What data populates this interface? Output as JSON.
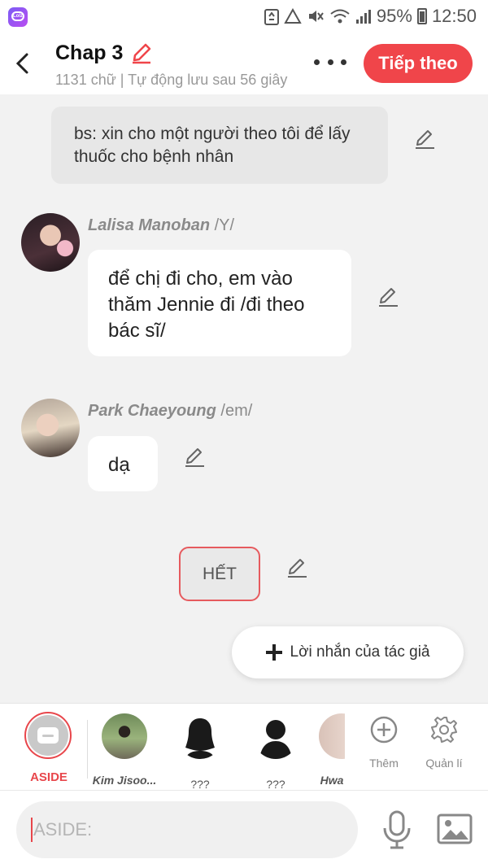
{
  "status_bar": {
    "battery": "95%",
    "time": "12:50"
  },
  "header": {
    "title": "Chap 3",
    "subtitle": "1131 chữ | Tự động lưu sau 56 giây",
    "next_label": "Tiếp theo"
  },
  "messages": {
    "narration": "bs: xin cho một người theo tôi để lấy thuốc cho bệnh nhân",
    "lisa": {
      "name": "Lalisa Manoban",
      "role": "/Y/",
      "text": "để chị đi cho, em vào thăm Jennie đi /đi theo bác sĩ/"
    },
    "rose": {
      "name": "Park Chaeyoung",
      "role": "/em/",
      "text": "dạ"
    },
    "end_label": "HẾT"
  },
  "author_note_label": "Lời nhắn của tác giả",
  "characters": {
    "aside": "ASIDE",
    "items": [
      "Kim Jisoo...",
      "???",
      "???",
      "Hwa"
    ],
    "add": "Thêm",
    "manage": "Quản lí"
  },
  "input": {
    "placeholder": "ASIDE:"
  },
  "colors": {
    "accent": "#f0454a",
    "bubble": "#ffffff",
    "narration_bg": "#e7e7e7"
  }
}
